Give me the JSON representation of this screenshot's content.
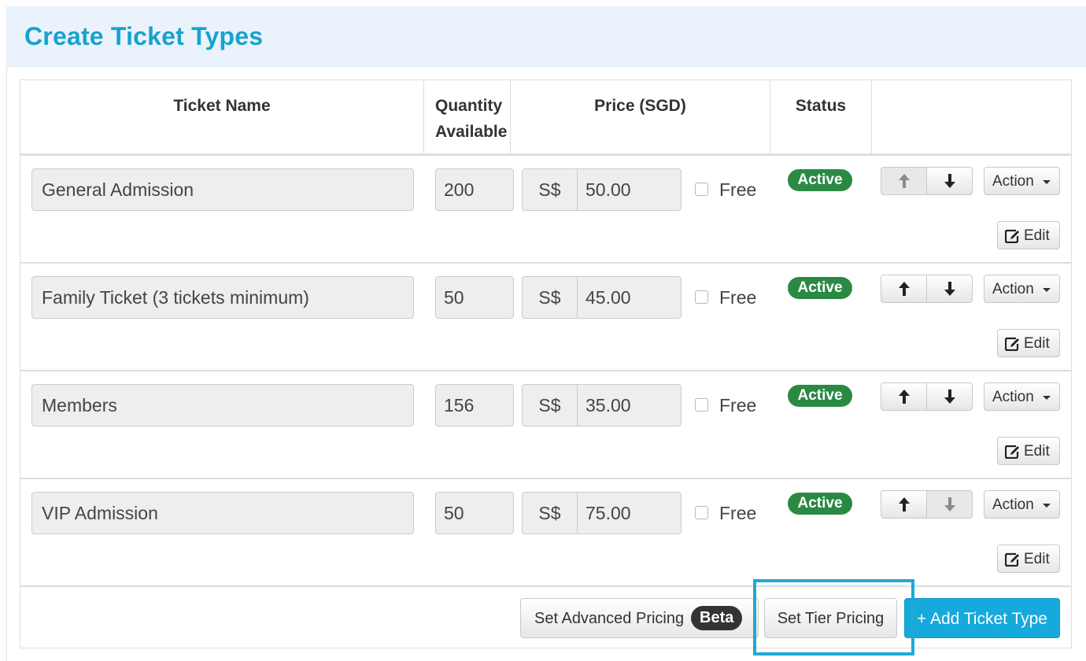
{
  "panel": {
    "title": "Create Ticket Types"
  },
  "table": {
    "headers": {
      "ticket_name": "Ticket Name",
      "quantity_line1": "Quantity",
      "quantity_line2": "Available",
      "price": "Price (SGD)",
      "status": "Status"
    },
    "rows": [
      {
        "name": "General Admission",
        "quantity": "200",
        "currency": "S$",
        "price": "50.00",
        "free_label": "Free",
        "free_checked": false,
        "status": "Active",
        "move_up_enabled": false,
        "move_down_enabled": true,
        "action_label": "Action",
        "edit_label": "Edit"
      },
      {
        "name": "Family Ticket (3 tickets minimum)",
        "quantity": "50",
        "currency": "S$",
        "price": "45.00",
        "free_label": "Free",
        "free_checked": false,
        "status": "Active",
        "move_up_enabled": true,
        "move_down_enabled": true,
        "action_label": "Action",
        "edit_label": "Edit"
      },
      {
        "name": "Members",
        "quantity": "156",
        "currency": "S$",
        "price": "35.00",
        "free_label": "Free",
        "free_checked": false,
        "status": "Active",
        "move_up_enabled": true,
        "move_down_enabled": true,
        "action_label": "Action",
        "edit_label": "Edit"
      },
      {
        "name": "VIP Admission",
        "quantity": "50",
        "currency": "S$",
        "price": "75.00",
        "free_label": "Free",
        "free_checked": false,
        "status": "Active",
        "move_up_enabled": true,
        "move_down_enabled": false,
        "action_label": "Action",
        "edit_label": "Edit"
      }
    ]
  },
  "footer": {
    "advanced_pricing_label": "Set Advanced Pricing",
    "beta_badge": "Beta",
    "tier_pricing_label": "Set Tier Pricing",
    "add_ticket_label": "+ Add Ticket Type"
  },
  "colors": {
    "title": "#17a2cf",
    "active_badge": "#2a8a44",
    "primary_button": "#16a9dc",
    "highlight_box": "#1ea9d6"
  },
  "icons": {
    "move_up": "arrow-up-icon",
    "move_down": "arrow-down-icon",
    "edit": "edit-icon",
    "dropdown": "caret-down-icon"
  }
}
